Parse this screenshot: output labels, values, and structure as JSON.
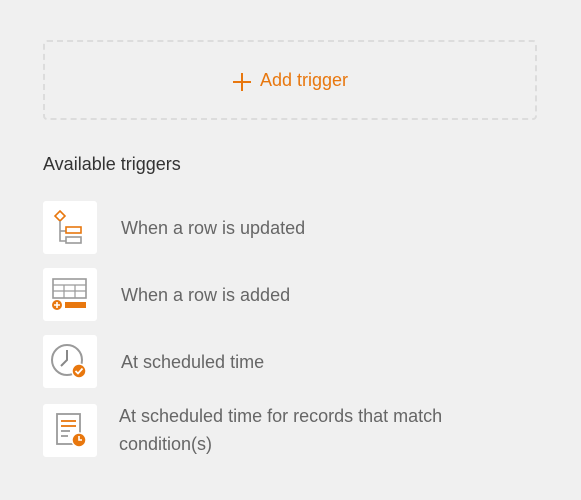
{
  "add_trigger": {
    "label": "Add trigger",
    "icon": "plus-icon",
    "color": "#e8770e"
  },
  "available_triggers": {
    "title": "Available triggers",
    "items": [
      {
        "label": "When a row is updated",
        "icon": "row-updated-icon"
      },
      {
        "label": "When a row is added",
        "icon": "row-added-icon"
      },
      {
        "label": "At scheduled time",
        "icon": "scheduled-time-icon"
      },
      {
        "label": "At scheduled time for records that match condition(s)",
        "icon": "scheduled-records-icon"
      }
    ]
  }
}
